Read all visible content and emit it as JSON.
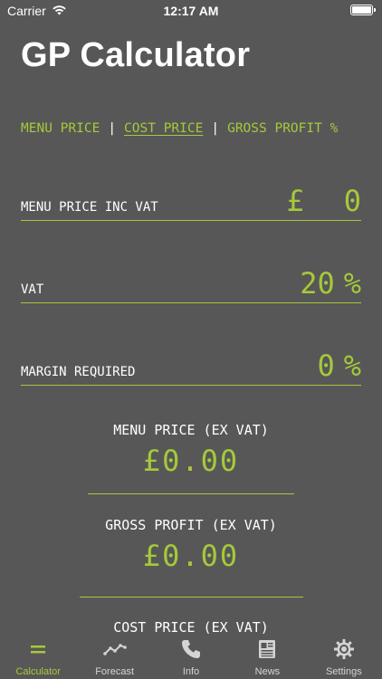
{
  "status": {
    "carrier": "Carrier",
    "time": "12:17 AM"
  },
  "app": {
    "title": "GP Calculator"
  },
  "modes": [
    {
      "label": "MENU PRICE",
      "active": false
    },
    {
      "label": "COST PRICE",
      "active": true
    },
    {
      "label": "GROSS PROFIT %",
      "active": false
    }
  ],
  "mode_separator": "|",
  "fields": {
    "menu_price": {
      "label": "MENU PRICE INC VAT",
      "currency": "£",
      "value": "0"
    },
    "vat": {
      "label": "VAT",
      "value": "20",
      "unit": "%"
    },
    "margin": {
      "label": "MARGIN REQUIRED",
      "value": "0",
      "unit": "%"
    }
  },
  "results": {
    "menu_price_ex_vat": {
      "label": "MENU PRICE (EX VAT)",
      "currency": "£",
      "value": "0.00"
    },
    "gross_profit_ex_vat": {
      "label": "GROSS PROFIT (EX VAT)",
      "currency": "£",
      "value": "0.00"
    },
    "cost_price_ex_vat": {
      "label": "COST PRICE (EX VAT)"
    }
  },
  "tabs": [
    {
      "label": "Calculator",
      "icon": "equals-icon",
      "active": true
    },
    {
      "label": "Forecast",
      "icon": "line-chart-icon",
      "active": false
    },
    {
      "label": "Info",
      "icon": "phone-icon",
      "active": false
    },
    {
      "label": "News",
      "icon": "newspaper-icon",
      "active": false
    },
    {
      "label": "Settings",
      "icon": "gear-icon",
      "active": false
    }
  ],
  "colors": {
    "accent": "#a5c93a",
    "background": "#575757",
    "text": "#ffffff"
  }
}
